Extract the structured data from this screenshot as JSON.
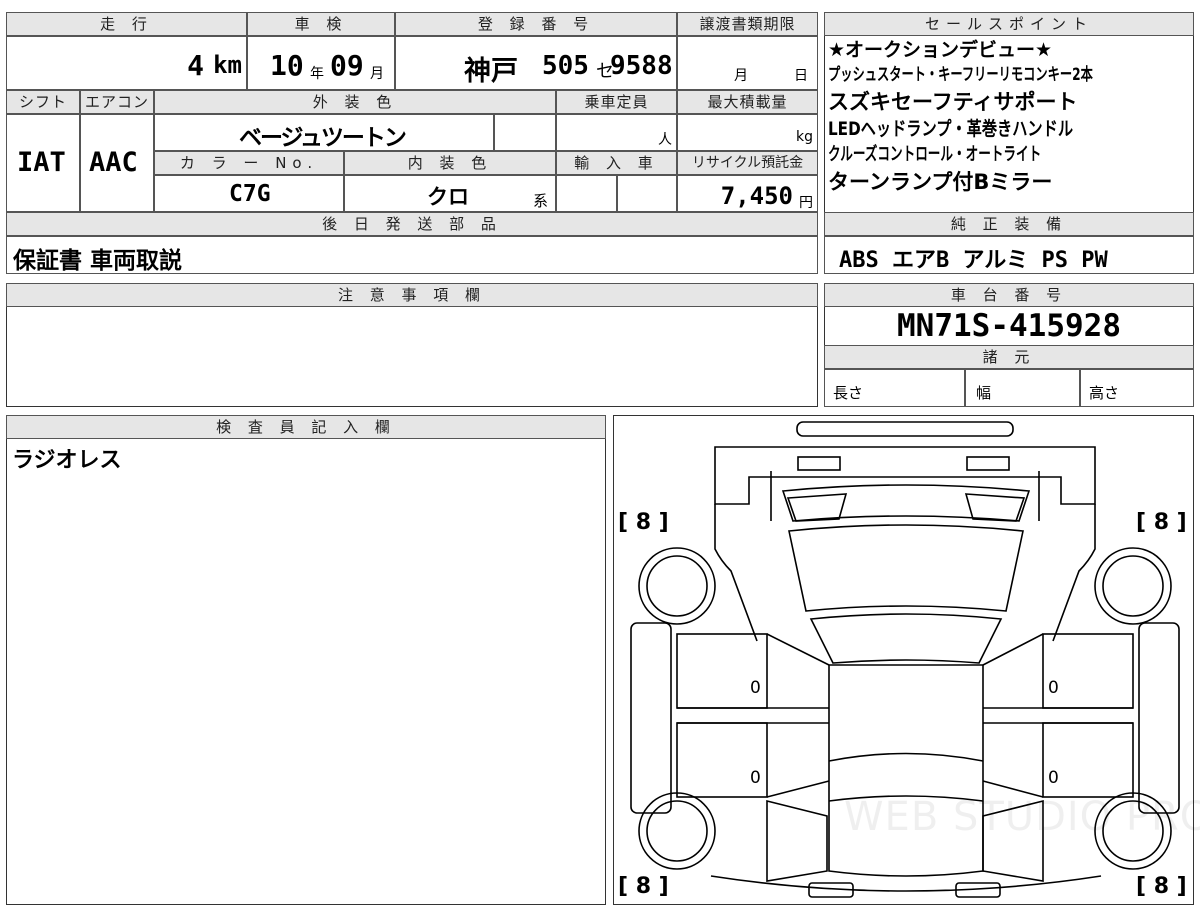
{
  "top_table": {
    "mileage_label": "走 行",
    "mileage_value": "4",
    "mileage_unit": "km",
    "shaken_label": "車 検",
    "shaken_year": "10",
    "shaken_year_unit": "年",
    "shaken_month": "09",
    "shaken_month_unit": "月",
    "reg_label": "登 録 番 号",
    "reg_area": "神戸",
    "reg_class": "505",
    "reg_kana": "セ",
    "reg_number": "9588",
    "transfer_label": "譲渡書類期限",
    "transfer_month": "月",
    "transfer_day": "日",
    "shift_label": "シフト",
    "ac_label": "エアコン",
    "exterior_label": "外 装 色",
    "capacity_label": "乗車定員",
    "maxload_label": "最大積載量",
    "shift_value": "IAT",
    "ac_value": "AAC",
    "exterior_value": "ベージュツートン",
    "capacity_unit": "人",
    "maxload_unit": "kg",
    "color_no_label": "カ ラ ー No.",
    "interior_label": "内 装 色",
    "import_label": "輸 入 車",
    "recycle_label": "リサイクル預託金",
    "color_no_value": "C7G",
    "interior_value": "クロ",
    "interior_suffix": "系",
    "recycle_value": "7,450",
    "recycle_unit": "円",
    "later_parts_label": "後 日 発 送 部 品",
    "later_parts_value": "保証書 車両取説"
  },
  "sales_points": {
    "label": "セールスポイント",
    "lines": [
      "★オークションデビュー★",
      "プッシュスタート・キーフリーリモコンキー2本",
      "スズキセーフティサポート",
      "LEDヘッドランプ・革巻きハンドル",
      "クルーズコントロール・オートライト",
      "ターンランプ付Bミラー"
    ]
  },
  "equipment": {
    "label": "純 正 装 備",
    "value": "ABS エアB アルミ PS PW"
  },
  "notes": {
    "label": "注 意 事 項 欄",
    "value": ""
  },
  "chassis": {
    "label": "車 台 番 号",
    "value": "MN71S-415928"
  },
  "specs": {
    "label": "諸 元",
    "length_label": "長さ",
    "width_label": "幅",
    "height_label": "高さ"
  },
  "inspector": {
    "label": "検 査 員 記 入 欄",
    "value": "ラジオレス"
  },
  "diagram": {
    "tire_front_left": "[ 8 ]",
    "tire_front_right": "[ 8 ]",
    "tire_rear_left": "[ 8 ]",
    "tire_rear_right": "[ 8 ]",
    "door_front_left": "0",
    "door_rear_left": "0",
    "door_front_right": "0",
    "door_rear_right": "0",
    "watermark": "WEB STUDIO PRO"
  }
}
